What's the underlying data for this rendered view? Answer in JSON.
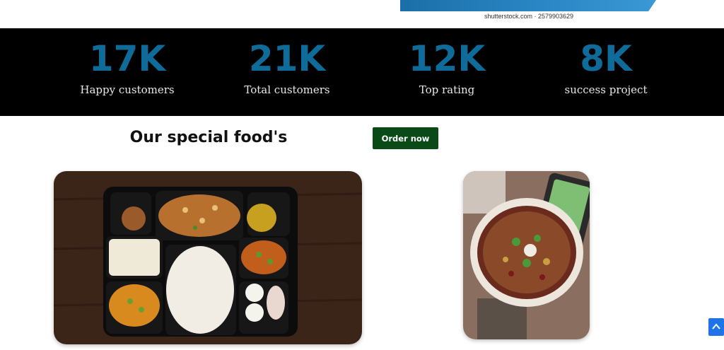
{
  "top_image": {
    "credit": "shutterstock.com · 2579903629"
  },
  "stats": [
    {
      "number": "17K",
      "label": "Happy customers"
    },
    {
      "number": "21K",
      "label": "Total customers"
    },
    {
      "number": "12K",
      "label": "Top rating"
    },
    {
      "number": "8K",
      "label": "success project"
    }
  ],
  "specials": {
    "title": "Our special food's",
    "order_label": "Order now"
  },
  "colors": {
    "stat_number": "#0f6b9a",
    "band_background": "#000000",
    "order_button": "#0a4a16",
    "scroll_button": "#1e73e8"
  },
  "icons": {
    "scroll_top": "chevron-up-icon"
  }
}
